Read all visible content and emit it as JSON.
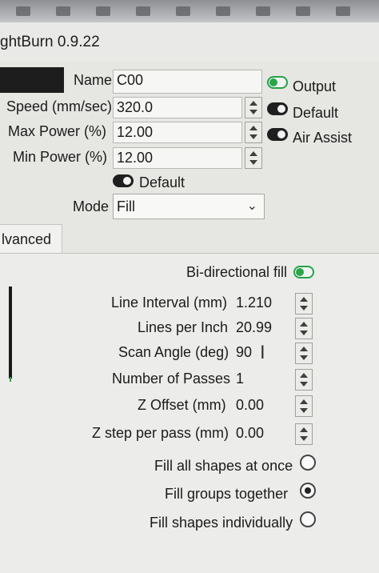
{
  "app": {
    "title": "ghtBurn 0.9.22"
  },
  "layer": {
    "name_label": "Name",
    "name_value": "C00",
    "output_label": "Output",
    "default_label_1": "Default",
    "air_assist_label": "Air Assist",
    "speed_label": "Speed (mm/sec)",
    "speed_value": "320.0",
    "max_power_label": "Max Power (%)",
    "max_power_value": "12.00",
    "min_power_label": "Min Power (%)",
    "min_power_value": "12.00",
    "default_label_2": "Default",
    "mode_label": "Mode",
    "mode_value": "Fill"
  },
  "tab": {
    "label": "lvanced"
  },
  "fill": {
    "bidirectional_label": "Bi-directional fill",
    "line_interval_label": "Line Interval (mm)",
    "line_interval_value": "1.210",
    "lines_per_inch_label": "Lines per Inch",
    "lines_per_inch_value": "20.99",
    "scan_angle_label": "Scan Angle (deg)",
    "scan_angle_value": "90",
    "passes_label": "Number of Passes",
    "passes_value": "1",
    "z_offset_label": "Z Offset (mm)",
    "z_offset_value": "0.00",
    "z_step_label": "Z step per pass (mm)",
    "z_step_value": "0.00",
    "fill_all_label": "Fill all shapes at once",
    "fill_groups_label": "Fill groups together",
    "fill_individually_label": "Fill shapes individually"
  },
  "toggles": {
    "output": "on",
    "default_1": "off",
    "air_assist": "off",
    "default_2": "off",
    "bidirectional": "on"
  },
  "fill_mode_selected": "Fill groups together"
}
